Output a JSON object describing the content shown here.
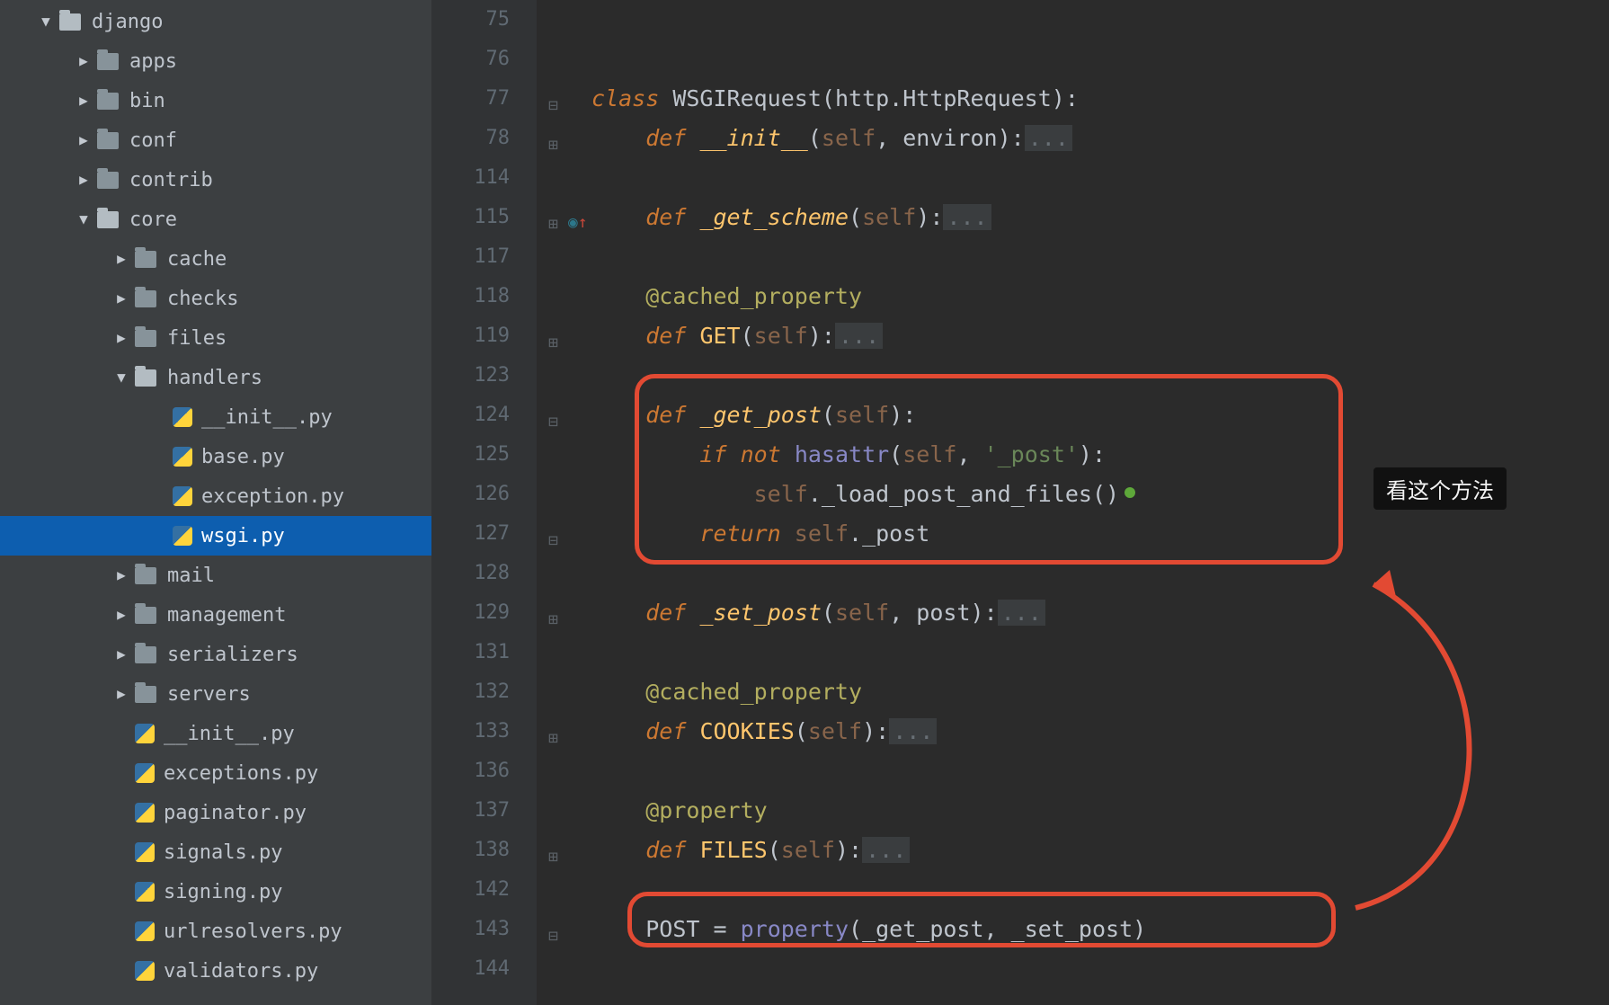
{
  "annotation": {
    "tooltip": "看这个方法"
  },
  "tree": [
    {
      "depth": 1,
      "arrow": "down",
      "icon": "folder-open",
      "label": "django"
    },
    {
      "depth": 2,
      "arrow": "right",
      "icon": "folder",
      "label": "apps"
    },
    {
      "depth": 2,
      "arrow": "right",
      "icon": "folder",
      "label": "bin"
    },
    {
      "depth": 2,
      "arrow": "right",
      "icon": "folder",
      "label": "conf"
    },
    {
      "depth": 2,
      "arrow": "right",
      "icon": "folder",
      "label": "contrib"
    },
    {
      "depth": 2,
      "arrow": "down",
      "icon": "folder-open",
      "label": "core"
    },
    {
      "depth": 3,
      "arrow": "right",
      "icon": "folder",
      "label": "cache"
    },
    {
      "depth": 3,
      "arrow": "right",
      "icon": "folder",
      "label": "checks"
    },
    {
      "depth": 3,
      "arrow": "right",
      "icon": "folder",
      "label": "files"
    },
    {
      "depth": 3,
      "arrow": "down",
      "icon": "folder-open",
      "label": "handlers"
    },
    {
      "depth": 4,
      "arrow": "none",
      "icon": "py",
      "label": "__init__.py"
    },
    {
      "depth": 4,
      "arrow": "none",
      "icon": "py",
      "label": "base.py"
    },
    {
      "depth": 4,
      "arrow": "none",
      "icon": "py",
      "label": "exception.py"
    },
    {
      "depth": 4,
      "arrow": "none",
      "icon": "py",
      "label": "wsgi.py",
      "selected": true
    },
    {
      "depth": 3,
      "arrow": "right",
      "icon": "folder",
      "label": "mail"
    },
    {
      "depth": 3,
      "arrow": "right",
      "icon": "folder",
      "label": "management"
    },
    {
      "depth": 3,
      "arrow": "right",
      "icon": "folder",
      "label": "serializers"
    },
    {
      "depth": 3,
      "arrow": "right",
      "icon": "folder",
      "label": "servers"
    },
    {
      "depth": 3,
      "arrow": "none",
      "icon": "py",
      "label": "__init__.py"
    },
    {
      "depth": 3,
      "arrow": "none",
      "icon": "py",
      "label": "exceptions.py"
    },
    {
      "depth": 3,
      "arrow": "none",
      "icon": "py",
      "label": "paginator.py"
    },
    {
      "depth": 3,
      "arrow": "none",
      "icon": "py",
      "label": "signals.py"
    },
    {
      "depth": 3,
      "arrow": "none",
      "icon": "py",
      "label": "signing.py"
    },
    {
      "depth": 3,
      "arrow": "none",
      "icon": "py",
      "label": "urlresolvers.py"
    },
    {
      "depth": 3,
      "arrow": "none",
      "icon": "py",
      "label": "validators.py"
    }
  ],
  "gutterLines": [
    "75",
    "76",
    "77",
    "78",
    "114",
    "115",
    "117",
    "118",
    "119",
    "123",
    "124",
    "125",
    "126",
    "127",
    "128",
    "129",
    "131",
    "132",
    "133",
    "136",
    "137",
    "138",
    "142",
    "143",
    "144"
  ],
  "code": {
    "l77": {
      "kw": "class",
      "sp": " ",
      "name": "WSGIRequest",
      "open": "(",
      "base": "http.HttpRequest",
      "close": "):"
    },
    "l78": {
      "kw": "def",
      "sp": " ",
      "name": "__init__",
      "open": "(",
      "p1": "self",
      "comma": ", ",
      "p2": "environ",
      "close": "):",
      "fold": "..."
    },
    "l115": {
      "kw": "def",
      "sp": " ",
      "name": "_get_scheme",
      "open": "(",
      "p1": "self",
      "close": "):",
      "fold": "..."
    },
    "l118": {
      "dec": "@cached_property"
    },
    "l119": {
      "kw": "def",
      "sp": " ",
      "name": "GET",
      "open": "(",
      "p1": "self",
      "close": "):",
      "fold": "..."
    },
    "l124": {
      "kw": "def",
      "sp": " ",
      "name": "_get_post",
      "open": "(",
      "p1": "self",
      "close": "):"
    },
    "l125": {
      "kw1": "if",
      "sp1": " ",
      "kw2": "not",
      "sp2": " ",
      "call": "hasattr",
      "open": "(",
      "p1": "self",
      "comma": ", ",
      "str": "'_post'",
      "close": "):"
    },
    "l126": {
      "p1": "self",
      "dot": ".",
      "call": "_load_post_and_files",
      "paren": "()"
    },
    "l127": {
      "kw": "return",
      "sp": " ",
      "p1": "self",
      "dot": ".",
      "attr": "_post"
    },
    "l129": {
      "kw": "def",
      "sp": " ",
      "name": "_set_post",
      "open": "(",
      "p1": "self",
      "comma": ", ",
      "p2": "post",
      "close": "):",
      "fold": "..."
    },
    "l132": {
      "dec": "@cached_property"
    },
    "l133": {
      "kw": "def",
      "sp": " ",
      "name": "COOKIES",
      "open": "(",
      "p1": "self",
      "close": "):",
      "fold": "..."
    },
    "l137": {
      "dec": "@property"
    },
    "l138": {
      "kw": "def",
      "sp": " ",
      "name": "FILES",
      "open": "(",
      "p1": "self",
      "close": "):",
      "fold": "..."
    },
    "l143": {
      "lhs": "POST",
      "eq": " = ",
      "call": "property",
      "open": "(",
      "a1": "_get_post",
      "comma": ", ",
      "a2": "_set_post",
      "close": ")"
    }
  }
}
